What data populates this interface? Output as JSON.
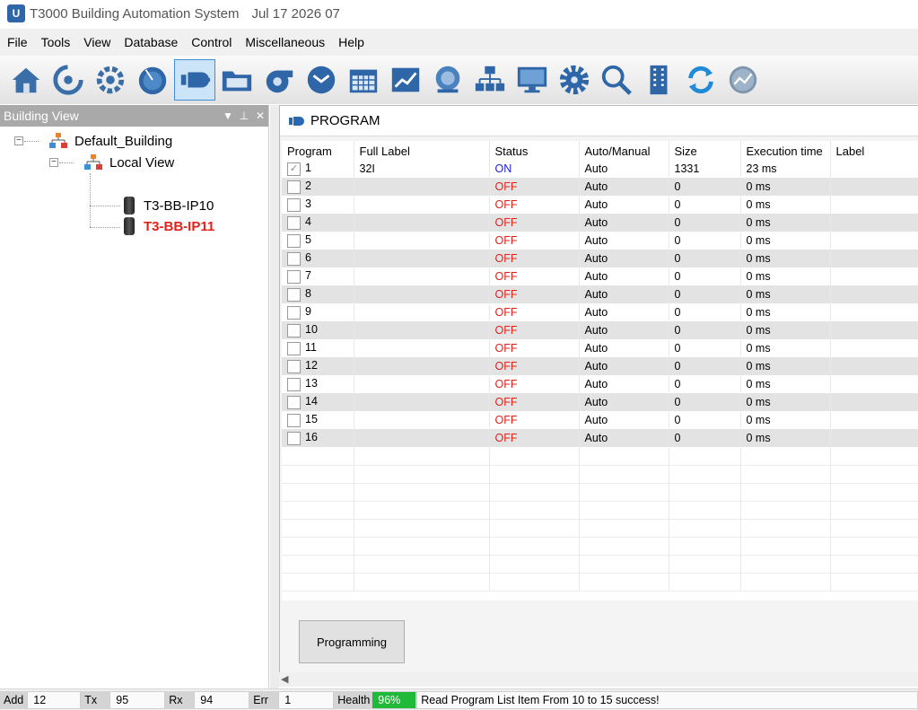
{
  "window": {
    "title": "T3000 Building Automation System",
    "datetime": "Jul 17 2026 07"
  },
  "menu": [
    "File",
    "Tools",
    "View",
    "Database",
    "Control",
    "Miscellaneous",
    "Help"
  ],
  "toolbar": {
    "active_icon": "program-icon",
    "icons": [
      "home-icon",
      "refresh-cycle-icon",
      "gear-cycle-icon",
      "dial-icon",
      "program-icon",
      "folder-icon",
      "fan-icon",
      "clock-icon",
      "calendar-icon",
      "trend-chart-icon",
      "alarm-icon",
      "network-tree-icon",
      "monitor-icon",
      "settings-gear-icon",
      "search-icon",
      "building-icon",
      "sync-icon",
      "graph-icon"
    ]
  },
  "building_view": {
    "title": "Building View",
    "tree": {
      "building": "Default_Building",
      "view": "Local View",
      "devices": [
        {
          "label": "T3-BB-IP10",
          "active": false
        },
        {
          "label": "T3-BB-IP11",
          "active": true
        }
      ]
    }
  },
  "program_panel": {
    "title": "PROGRAM",
    "columns": [
      "Program",
      "Full Label",
      "Status",
      "Auto/Manual",
      "Size",
      "Execution time",
      "Label"
    ],
    "rows": [
      {
        "program": "1",
        "full_label": "32I",
        "status": "ON",
        "mode": "Auto",
        "size": "1331",
        "exec": "23 ms",
        "label": "",
        "checked": true
      },
      {
        "program": "2",
        "full_label": "",
        "status": "OFF",
        "mode": "Auto",
        "size": "0",
        "exec": "0 ms",
        "label": "",
        "checked": false
      },
      {
        "program": "3",
        "full_label": "",
        "status": "OFF",
        "mode": "Auto",
        "size": "0",
        "exec": "0 ms",
        "label": "",
        "checked": false
      },
      {
        "program": "4",
        "full_label": "",
        "status": "OFF",
        "mode": "Auto",
        "size": "0",
        "exec": "0 ms",
        "label": "",
        "checked": false
      },
      {
        "program": "5",
        "full_label": "",
        "status": "OFF",
        "mode": "Auto",
        "size": "0",
        "exec": "0 ms",
        "label": "",
        "checked": false
      },
      {
        "program": "6",
        "full_label": "",
        "status": "OFF",
        "mode": "Auto",
        "size": "0",
        "exec": "0 ms",
        "label": "",
        "checked": false
      },
      {
        "program": "7",
        "full_label": "",
        "status": "OFF",
        "mode": "Auto",
        "size": "0",
        "exec": "0 ms",
        "label": "",
        "checked": false
      },
      {
        "program": "8",
        "full_label": "",
        "status": "OFF",
        "mode": "Auto",
        "size": "0",
        "exec": "0 ms",
        "label": "",
        "checked": false
      },
      {
        "program": "9",
        "full_label": "",
        "status": "OFF",
        "mode": "Auto",
        "size": "0",
        "exec": "0 ms",
        "label": "",
        "checked": false
      },
      {
        "program": "10",
        "full_label": "",
        "status": "OFF",
        "mode": "Auto",
        "size": "0",
        "exec": "0 ms",
        "label": "",
        "checked": false
      },
      {
        "program": "11",
        "full_label": "",
        "status": "OFF",
        "mode": "Auto",
        "size": "0",
        "exec": "0 ms",
        "label": "",
        "checked": false
      },
      {
        "program": "12",
        "full_label": "",
        "status": "OFF",
        "mode": "Auto",
        "size": "0",
        "exec": "0 ms",
        "label": "",
        "checked": false
      },
      {
        "program": "13",
        "full_label": "",
        "status": "OFF",
        "mode": "Auto",
        "size": "0",
        "exec": "0 ms",
        "label": "",
        "checked": false
      },
      {
        "program": "14",
        "full_label": "",
        "status": "OFF",
        "mode": "Auto",
        "size": "0",
        "exec": "0 ms",
        "label": "",
        "checked": false
      },
      {
        "program": "15",
        "full_label": "",
        "status": "OFF",
        "mode": "Auto",
        "size": "0",
        "exec": "0 ms",
        "label": "",
        "checked": false
      },
      {
        "program": "16",
        "full_label": "",
        "status": "OFF",
        "mode": "Auto",
        "size": "0",
        "exec": "0 ms",
        "label": "",
        "checked": false
      }
    ],
    "programming_button": "Programming"
  },
  "status_bar": {
    "add_label": "Add",
    "add_value": "12",
    "tx_label": "Tx",
    "tx_value": "95",
    "rx_label": "Rx",
    "rx_value": "94",
    "err_label": "Err",
    "err_value": "1",
    "health_label": "Health",
    "health_value": "96%",
    "message": "Read Program List Item From 10 to 15  success!"
  },
  "colors": {
    "status_on": "#1e1ed8",
    "status_off": "#e8201a",
    "health": "#1fba3a",
    "active_device": "#e0221b"
  }
}
